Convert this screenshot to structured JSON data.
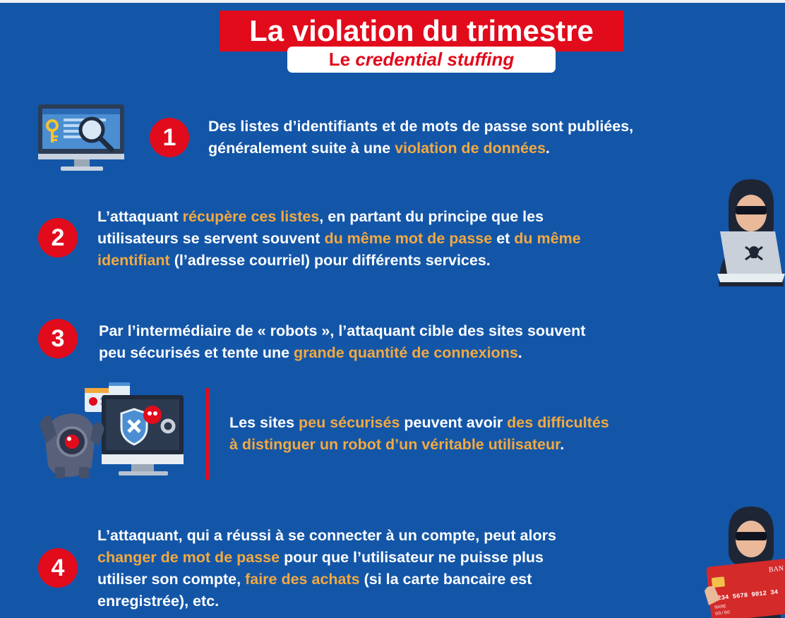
{
  "header": {
    "title": "La violation du trimestre",
    "subtitle_prefix": "Le ",
    "subtitle_em": "credential stuffing"
  },
  "colors": {
    "background": "#1356a8",
    "accent_red": "#e10b1c",
    "highlight": "#f3a940",
    "text": "#ffffff"
  },
  "steps": [
    {
      "number": "1",
      "line1": "Des listes d’identifiants et de mots de passe sont publiées,",
      "line2_a": "généralement suite à une ",
      "line2_hl": "violation de données",
      "line2_b": "."
    },
    {
      "number": "2",
      "line1_a": "L’attaquant ",
      "line1_hl": "récupère ces listes",
      "line1_b": ", en partant du principe que les",
      "line2_a": "utilisateurs se servent souvent  ",
      "line2_hl1": "du même mot de passe",
      "line2_b": " et ",
      "line2_hl2": "du même",
      "line3_hl": "identifiant",
      "line3_b": " (l’adresse courriel) pour différents services."
    },
    {
      "number": "3",
      "line1": "Par l’intermédiaire de « robots », l’attaquant cible des sites souvent",
      "line2_a": "peu sécurisés et tente une ",
      "line2_hl": "grande quantité de connexions",
      "line2_b": "."
    },
    {
      "number": "4",
      "line1": "L’attaquant, qui a réussi à se connecter à un compte, peut alors",
      "line2_hl": "changer de mot de passe",
      "line2_b": " pour que l’utilisateur ne puisse plus",
      "line3_a": "utiliser son compte, ",
      "line3_hl": "faire des achats",
      "line3_b": " (si la carte bancaire est",
      "line4": "enregistrée), etc."
    }
  ],
  "note": {
    "line1_a": "Les sites ",
    "line1_hl1": "peu sécurisés",
    "line1_b": " peuvent avoir ",
    "line1_hl2": "des difficultés",
    "line2_hl": "à distinguer un robot  d’un véritable utilisateur",
    "line2_b": "."
  },
  "card": {
    "number": "1234 5678 9012 34",
    "bank": "BAN",
    "name": "NAME",
    "expiry": "00/00"
  },
  "icons": {
    "monitor": "monitor-search-key-icon",
    "hacker_laptop": "hacker-laptop-skull-icon",
    "robot_screen": "robot-shield-screen-icon",
    "hacker_card": "hacker-credit-card-icon"
  }
}
